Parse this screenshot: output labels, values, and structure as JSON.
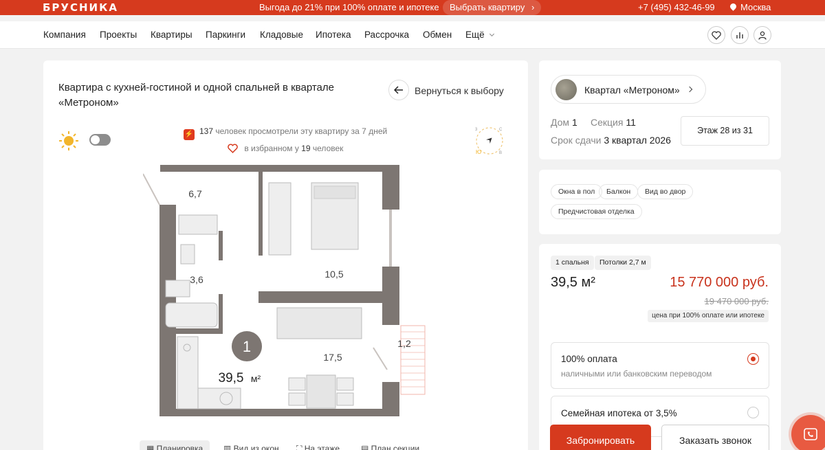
{
  "topbar": {
    "logo": "БРУСНИКА",
    "promo": "Выгода до 21% при 100% оплате и ипотеке",
    "promo_button": "Выбрать квартиру",
    "phone": "+7 (495) 432-46-99",
    "city": "Москва"
  },
  "nav": {
    "items": [
      "Компания",
      "Проекты",
      "Квартиры",
      "Паркинги",
      "Кладовые",
      "Ипотека",
      "Рассрочка",
      "Обмен"
    ],
    "more": "Ещё"
  },
  "listing": {
    "title": "Квартира с кухней-гостиной и одной спальней в квартале «Метроном»",
    "back": "Вернуться к выбору",
    "views_count": "137",
    "views_text": "человек просмотрели эту квартиру за 7 дней",
    "favorites_prefix": "в избранном у",
    "favorites_count": "19",
    "favorites_suffix": "человек"
  },
  "compass": {
    "n": "3",
    "e": "С",
    "s": "В",
    "w": "Ю"
  },
  "floorplan": {
    "rooms": [
      {
        "label": "6,7"
      },
      {
        "label": "10,5"
      },
      {
        "label": "3,6"
      },
      {
        "label": "17,5"
      },
      {
        "label": "1,2"
      }
    ],
    "bedrooms_badge": "1",
    "total_area": "39,5",
    "unit": "м²"
  },
  "plan_tabs": [
    "Планировка",
    "Вид из окон",
    "На этаже",
    "План секции"
  ],
  "info": {
    "quarter": "Квартал «Метроном»",
    "house_label": "Дом",
    "house": "1",
    "section_label": "Секция",
    "section": "11",
    "deadline_label": "Срок сдачи",
    "deadline": "3 квартал 2026",
    "floor": "Этаж 28 из 31"
  },
  "features": [
    "Окна в пол",
    "Балкон",
    "Вид во двор",
    "Предчистовая отделка"
  ],
  "pricing": {
    "badges": [
      "1 спальня",
      "Потолки 2,7 м"
    ],
    "area": "39,5 м²",
    "price": "15 770 000 руб.",
    "old_price": "19 470 000 руб.",
    "price_note": "цена при 100% оплате или ипотеке",
    "options": [
      {
        "title": "100% оплата",
        "subtitle": "наличными или банковским переводом",
        "checked": true
      },
      {
        "title": "Семейная ипотека от 3,5%",
        "subtitle": "",
        "checked": false
      }
    ],
    "book": "Забронировать",
    "call": "Заказать звонок"
  },
  "colors": {
    "accent": "#d63a1e",
    "price": "#c8321c"
  }
}
